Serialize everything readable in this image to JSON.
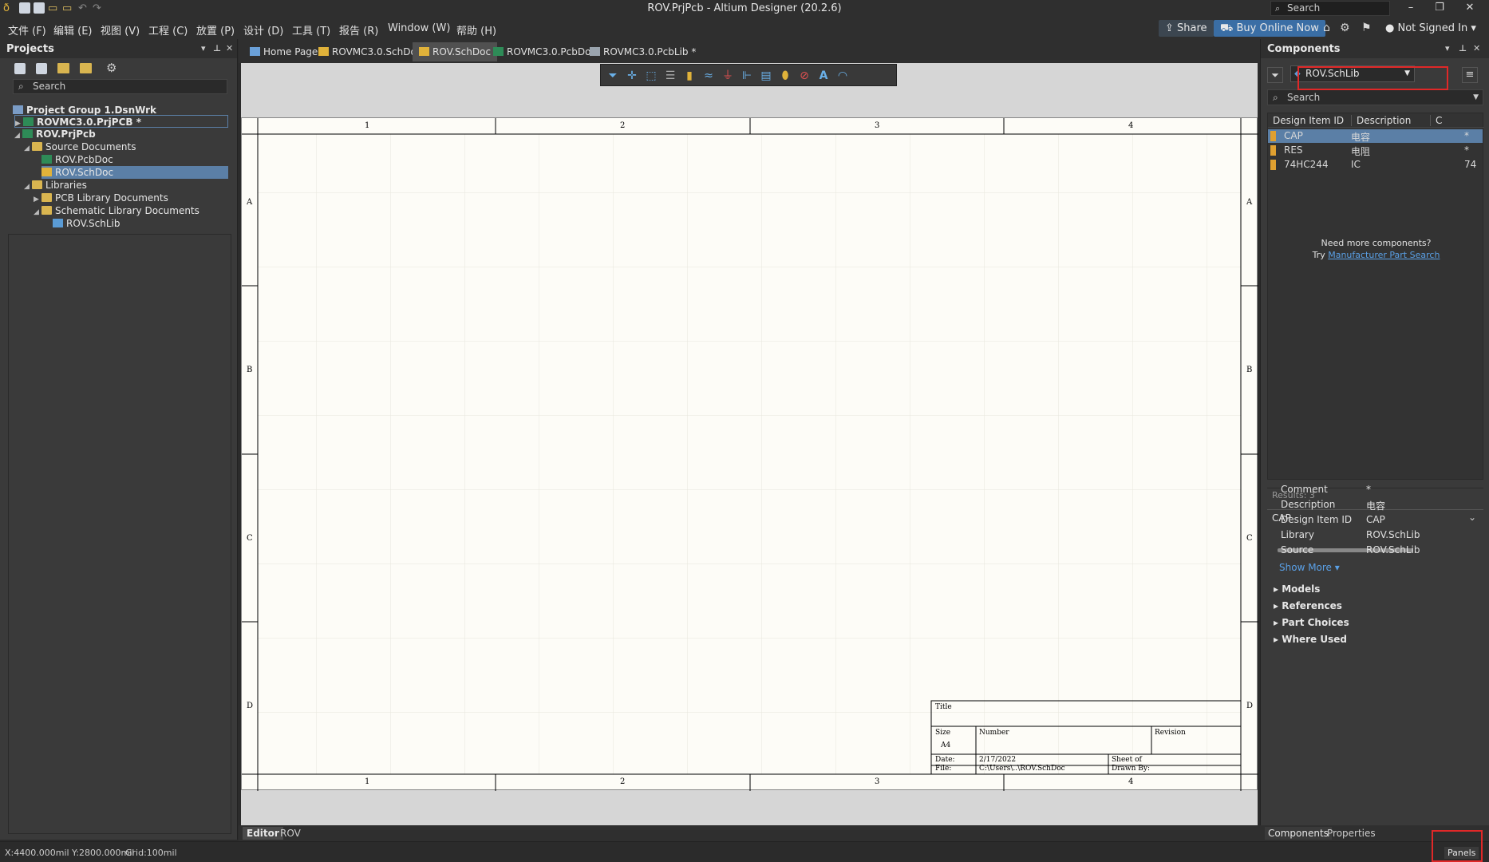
{
  "window": {
    "title": "ROV.PrjPcb - Altium Designer (20.2.6)",
    "search_placeholder": "Search"
  },
  "menubar": {
    "items": [
      "文件 (F)",
      "编辑 (E)",
      "视图 (V)",
      "工程 (C)",
      "放置 (P)",
      "设计 (D)",
      "工具 (T)",
      "报告 (R)",
      "Window (W)",
      "帮助 (H)"
    ],
    "share_label": "Share",
    "buy_label": "Buy Online Now",
    "account_label": "Not Signed In"
  },
  "projects": {
    "title": "Projects",
    "search_placeholder": "Search",
    "tree": [
      {
        "label": "Project Group 1.DsnWrk",
        "bold": true
      },
      {
        "label": "ROVMC3.0.PrjPCB *",
        "bold": true
      },
      {
        "label": "ROV.PrjPcb",
        "bold": true
      },
      {
        "label": "Source Documents"
      },
      {
        "label": "ROV.PcbDoc"
      },
      {
        "label": "ROV.SchDoc",
        "selected": true
      },
      {
        "label": "Libraries"
      },
      {
        "label": "PCB Library Documents"
      },
      {
        "label": "Schematic Library Documents"
      },
      {
        "label": "ROV.SchLib"
      }
    ]
  },
  "tabs": [
    "Home Page",
    "ROVMC3.0.SchDoc",
    "ROV.SchDoc",
    "ROVMC3.0.PcbDoc",
    "ROVMC3.0.PcbLib *"
  ],
  "active_tab": "ROV.SchDoc",
  "sheet": {
    "col_labels": [
      "1",
      "2",
      "3",
      "4"
    ],
    "row_labels": [
      "A",
      "B",
      "C",
      "D"
    ],
    "title_block": {
      "title": "Title",
      "size_label": "Size",
      "size_value": "A4",
      "number_label": "Number",
      "revision_label": "Revision",
      "date_label": "Date:",
      "date_value": "2/17/2022",
      "sheet_label": "Sheet   of",
      "file_label": "File:",
      "file_value": "C:\\Users\\..\\ROV.SchDoc",
      "drawn_label": "Drawn By:"
    }
  },
  "editor_tabs": [
    "Editor",
    "ROV"
  ],
  "components": {
    "title": "Components",
    "library": "ROV.SchLib",
    "search_placeholder": "Search",
    "columns": [
      "Design Item ID",
      "Description",
      "C"
    ],
    "rows": [
      {
        "id": "CAP",
        "desc": "电容",
        "c": "*"
      },
      {
        "id": "RES",
        "desc": "电阻",
        "c": "*"
      },
      {
        "id": "74HC244",
        "desc": "IC",
        "c": "74"
      }
    ],
    "need_more": "Need more components?",
    "try_label": "Try",
    "mps_link": "Manufacturer Part Search",
    "results": "Results: 3",
    "detail_title": "CAP",
    "props": [
      {
        "key": "Comment",
        "value": "*"
      },
      {
        "key": "Description",
        "value": "电容"
      },
      {
        "key": "Design Item ID",
        "value": "CAP"
      },
      {
        "key": "Library",
        "value": "ROV.SchLib"
      },
      {
        "key": "Source",
        "value": "ROV.SchLib"
      }
    ],
    "show_more": "Show More ▾",
    "sections": [
      "Models",
      "References",
      "Part Choices",
      "Where Used"
    ],
    "bottom_tabs": [
      "Components",
      "Properties"
    ]
  },
  "status": {
    "coords": "X:4400.000mil Y:2800.000mil",
    "grid": "Grid:100mil",
    "panels": "Panels"
  },
  "colors": {
    "accent_blue": "#3a6ea5",
    "highlight_red": "#e02828",
    "selected": "#5b7fa6"
  }
}
